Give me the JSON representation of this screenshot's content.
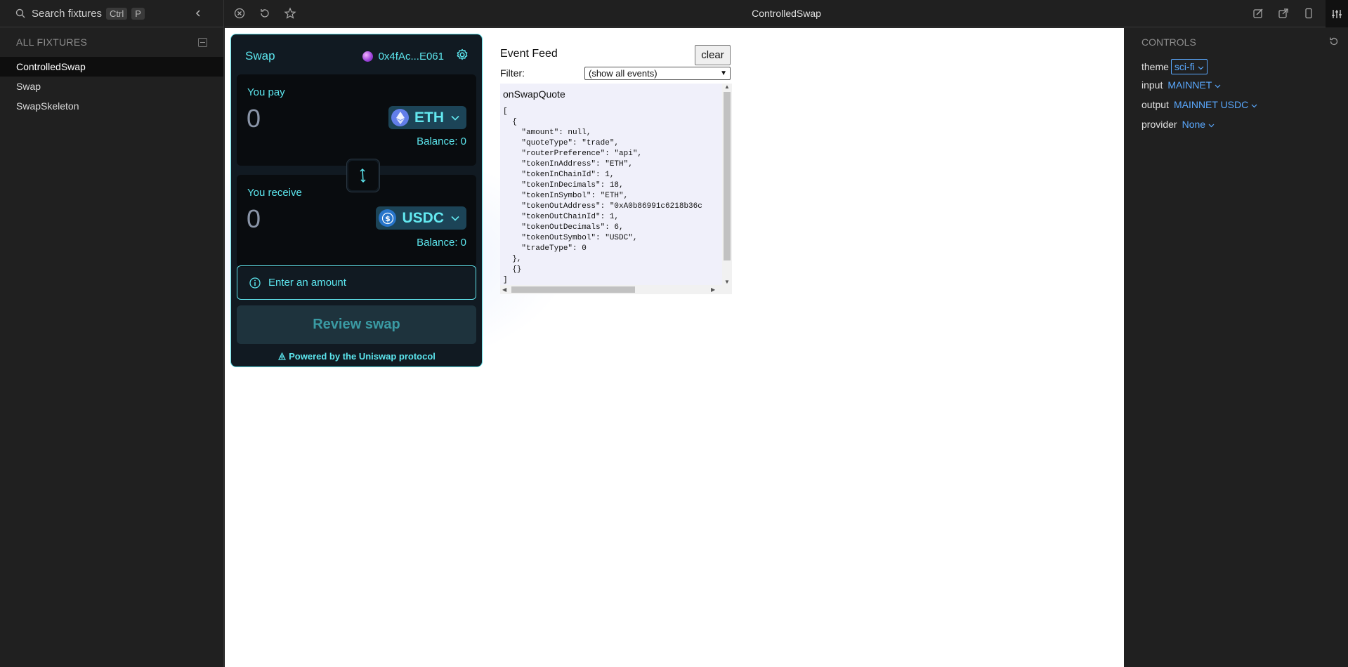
{
  "sidebar": {
    "search_placeholder": "Search fixtures",
    "shortcut_ctrl": "Ctrl",
    "shortcut_key": "P",
    "section_title": "ALL FIXTURES",
    "fixtures": [
      {
        "label": "ControlledSwap",
        "active": true
      },
      {
        "label": "Swap",
        "active": false
      },
      {
        "label": "SwapSkeleton",
        "active": false
      }
    ]
  },
  "topbar": {
    "title": "ControlledSwap",
    "left_icons": [
      "close-circle-icon",
      "reload-icon",
      "star-icon"
    ],
    "right_icons": [
      "edit-icon",
      "open-external-icon",
      "mobile-device-icon",
      "controls-toggle-icon"
    ]
  },
  "swap": {
    "title": "Swap",
    "account": "0x4fAc...E061",
    "pay_label": "You pay",
    "pay_amount": "0",
    "pay_token": "ETH",
    "pay_balance": "Balance: 0",
    "receive_label": "You receive",
    "receive_amount": "0",
    "receive_token": "USDC",
    "receive_balance": "Balance: 0",
    "notice": "Enter an amount",
    "review_button": "Review swap",
    "powered_by": "Powered by the Uniswap protocol",
    "accent_color": "#5ce6ee"
  },
  "feed": {
    "title": "Event Feed",
    "clear_button": "clear",
    "filter_label": "Filter:",
    "filter_selected": "(show all events)",
    "event_name": "onSwapQuote",
    "event_body": "[\n  {\n    \"amount\": null,\n    \"quoteType\": \"trade\",\n    \"routerPreference\": \"api\",\n    \"tokenInAddress\": \"ETH\",\n    \"tokenInChainId\": 1,\n    \"tokenInDecimals\": 18,\n    \"tokenInSymbol\": \"ETH\",\n    \"tokenOutAddress\": \"0xA0b86991c6218b36c\n    \"tokenOutChainId\": 1,\n    \"tokenOutDecimals\": 6,\n    \"tokenOutSymbol\": \"USDC\",\n    \"tradeType\": 0\n  },\n  {}\n]"
  },
  "controls": {
    "title": "CONTROLS",
    "items": [
      {
        "label": "theme",
        "value": "sci-fi"
      },
      {
        "label": "input",
        "value": "MAINNET"
      },
      {
        "label": "output",
        "value": "MAINNET USDC"
      },
      {
        "label": "provider",
        "value": "None"
      }
    ]
  }
}
